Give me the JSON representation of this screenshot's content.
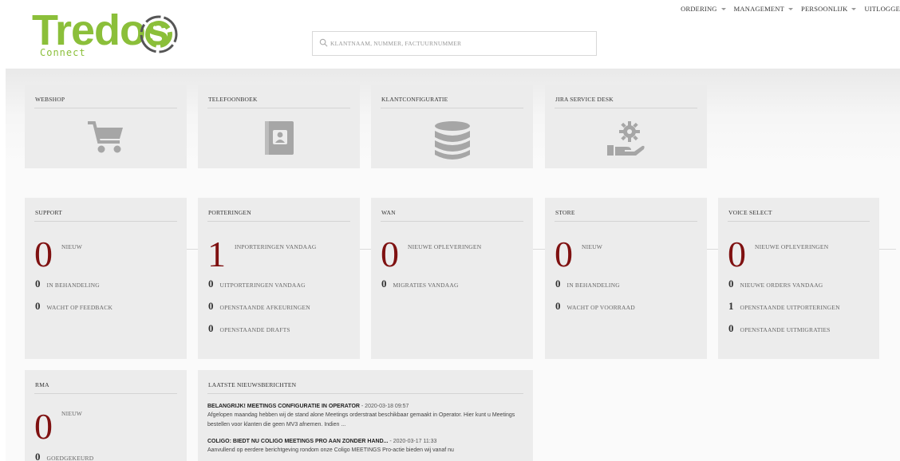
{
  "brand": {
    "logo_text": "Tredos",
    "logo_sub": "Connect",
    "accent": "#8bbf3a",
    "ring_color": "#555555"
  },
  "search": {
    "placeholder": "KLANTNAAM, NUMMER, FACTUURNUMMER",
    "value": ""
  },
  "nav": [
    {
      "label": "ORDERING",
      "has_caret": true
    },
    {
      "label": "MANAGEMENT",
      "has_caret": true
    },
    {
      "label": "PERSOONLIJK",
      "has_caret": true
    },
    {
      "label": "UITLOGGE",
      "has_caret": false
    }
  ],
  "quick_tiles": [
    {
      "title": "WEBSHOP",
      "icon": "cart-icon"
    },
    {
      "title": "TELEFOONBOEK",
      "icon": "contact-book-icon"
    },
    {
      "title": "KLANTCONFIGURATIE",
      "icon": "database-icon"
    },
    {
      "title": "JIRA SERVICE DESK",
      "icon": "service-hand-gear-icon"
    }
  ],
  "widgets": {
    "support": {
      "title": "SUPPORT",
      "big": {
        "value": "0",
        "label": "NIEUW"
      },
      "rows": [
        {
          "value": "0",
          "label": "IN BEHANDELING"
        },
        {
          "value": "0",
          "label": "WACHT OP FEEDBACK"
        }
      ]
    },
    "porteringen": {
      "title": "PORTERINGEN",
      "big": {
        "value": "1",
        "label": "INPORTERINGEN VANDAAG"
      },
      "rows": [
        {
          "value": "0",
          "label": "UITPORTERINGEN VANDAAG"
        },
        {
          "value": "0",
          "label": "OPENSTAANDE AFKEURINGEN"
        },
        {
          "value": "0",
          "label": "OPENSTAANDE DRAFTS"
        }
      ]
    },
    "wan": {
      "title": "WAN",
      "big": {
        "value": "0",
        "label": "NIEUWE OPLEVERINGEN"
      },
      "rows": [
        {
          "value": "0",
          "label": "MIGRATIES VANDAAG"
        }
      ]
    },
    "store": {
      "title": "STORE",
      "big": {
        "value": "0",
        "label": "NIEUW"
      },
      "rows": [
        {
          "value": "0",
          "label": "IN BEHANDELING"
        },
        {
          "value": "0",
          "label": "WACHT OP VOORRAAD"
        }
      ]
    },
    "voice_select": {
      "title": "VOICE SELECT",
      "big": {
        "value": "0",
        "label": "NIEUWE OPLEVERINGEN"
      },
      "rows": [
        {
          "value": "0",
          "label": "NIEUWE ORDERS VANDAAG"
        },
        {
          "value": "1",
          "label": "OPENSTAANDE UITPORTERINGEN"
        },
        {
          "value": "0",
          "label": "OPENSTAANDE UITMIGRATIES"
        }
      ]
    },
    "rma": {
      "title": "RMA",
      "big": {
        "value": "0",
        "label": "NIEUW"
      },
      "rows": [
        {
          "value": "0",
          "label": "GOEDGEKEURD"
        }
      ]
    }
  },
  "news": {
    "title": "LAATSTE NIEUWSBERICHTEN",
    "items": [
      {
        "title": "BELANGRIJK! MEETINGS CONFIGURATIE IN OPERATOR",
        "date": " - 2020-03-18 09:57",
        "body": "Afgelopen maandag hebben wij de stand alone Meetings orderstraat beschikbaar gemaakt in Operator. Hier kunt u Meetings bestellen voor klanten die geen MV3 afnemen. Indien ..."
      },
      {
        "title": "COLIGO: BIEDT NU COLIGO MEETINGS PRO AAN ZONDER HAND...",
        "date": " - 2020-03-17 11:33",
        "body": "Aanvullend op eerdere berichtgeving rondom onze Coligo MEETINGS Pro-actie bieden wij vanaf nu"
      }
    ]
  },
  "colors": {
    "big_number": "#7f1111",
    "tile_bg": "#ececec",
    "icon_grey": "#a6a6a6"
  }
}
